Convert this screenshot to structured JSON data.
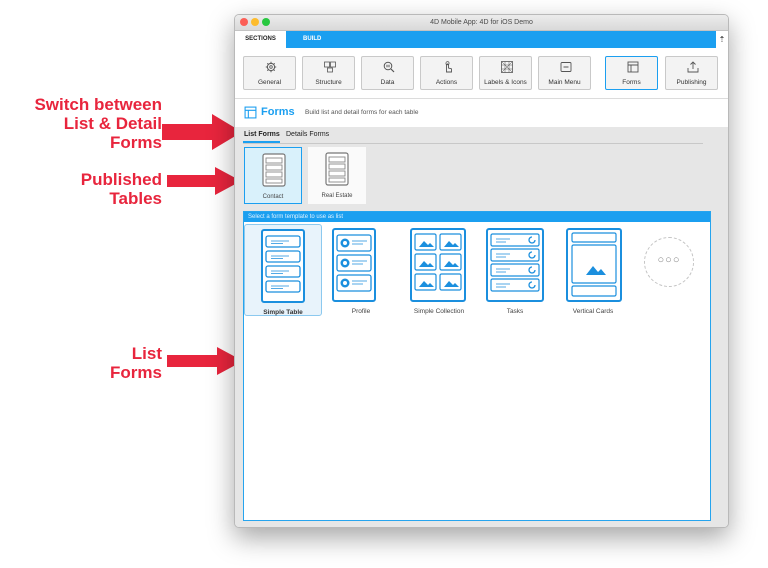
{
  "annotations": {
    "switch_line1": "Switch between",
    "switch_line2": "List & Detail",
    "switch_line3": "Forms",
    "published_line1": "Published",
    "published_line2": "Tables",
    "list_line1": "List",
    "list_line2": "Forms"
  },
  "window": {
    "title": "4D Mobile App: 4D for iOS Demo"
  },
  "top_tabs": {
    "sections": "SECTIONS",
    "build": "BUILD",
    "pin": "⇡"
  },
  "toolbar": {
    "items": [
      {
        "label": "General",
        "icon": "gear-icon"
      },
      {
        "label": "Structure",
        "icon": "structure-icon"
      },
      {
        "label": "Data",
        "icon": "data-search-icon"
      },
      {
        "label": "Actions",
        "icon": "hand-pointer-icon"
      },
      {
        "label": "Labels & Icons",
        "icon": "grid-icon"
      },
      {
        "label": "Main Menu",
        "icon": "menu-icon"
      },
      {
        "label": "Forms",
        "icon": "forms-icon"
      },
      {
        "label": "Publishing",
        "icon": "publish-icon"
      }
    ],
    "active": "Forms"
  },
  "section": {
    "title": "Forms",
    "description": "Build list and detail forms for each table"
  },
  "form_tabs": {
    "list": "List Forms",
    "details": "Details Forms"
  },
  "tables": [
    {
      "label": "Contact"
    },
    {
      "label": "Real Estate"
    }
  ],
  "list_panel": {
    "instruction": "Select a form template to use as list",
    "templates": [
      {
        "label": "Simple Table"
      },
      {
        "label": "Profile"
      },
      {
        "label": "Simple Collection"
      },
      {
        "label": "Tasks"
      },
      {
        "label": "Vertical Cards"
      }
    ],
    "more": "○○○"
  },
  "colors": {
    "accent": "#1b9ff0",
    "annotation": "#e8253d"
  }
}
